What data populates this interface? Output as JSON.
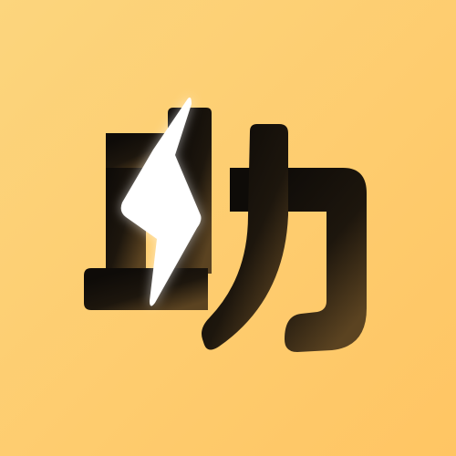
{
  "icon": {
    "glyph": "助",
    "icon_names": [
      "lightning-bolt-icon"
    ],
    "colors": {
      "background_start": "#fcd57d",
      "background_end": "#ffc563",
      "glyph_dark": "#0e0b08",
      "glyph_brown": "#5b4321",
      "bolt": "#ffffff"
    }
  }
}
